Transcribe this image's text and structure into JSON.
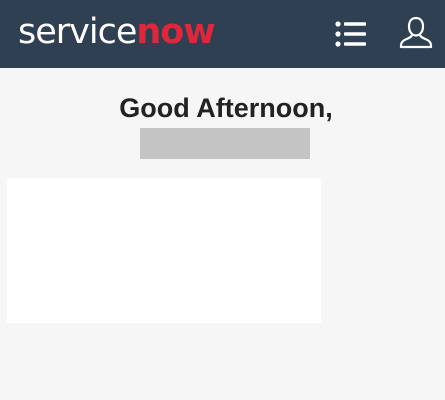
{
  "header": {
    "logo_part1": "service",
    "logo_part2": "now",
    "menu_icon": "list-menu-icon",
    "profile_icon": "user-profile-icon",
    "background_color": "#2f4052",
    "accent_color": "#e0263a"
  },
  "main": {
    "greeting": "Good Afternoon,"
  }
}
